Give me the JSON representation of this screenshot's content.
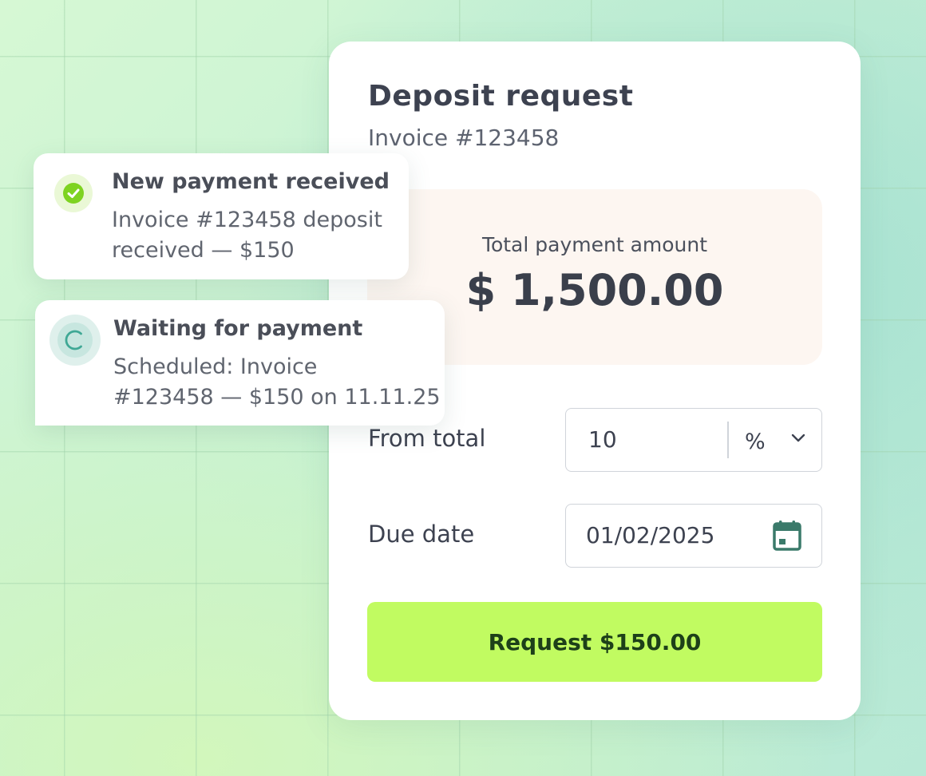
{
  "deposit": {
    "title": "Deposit request",
    "invoice": "Invoice #123458",
    "total_label": "Total payment amount",
    "total_amount": "$ 1,500.00",
    "from_total_label": "From total",
    "from_total_value": "10",
    "unit": "%",
    "due_date_label": "Due date",
    "due_date_value": "01/02/2025",
    "request_button": "Request $150.00"
  },
  "notifications": [
    {
      "title": "New payment received",
      "line1": "Invoice #123458 deposit",
      "line2": "received — $150",
      "icon": "check-circle-icon"
    },
    {
      "title": "Waiting for payment",
      "line1": "Scheduled: Invoice",
      "line2": "#123458 — $150 on 11.11.25",
      "icon": "spinner-icon"
    }
  ],
  "colors": {
    "accent_button": "#c1fb61",
    "button_text": "#1d4019",
    "success_green": "#7ed321",
    "pending_teal": "#3fa895",
    "total_box_bg": "#fdf6f1"
  }
}
